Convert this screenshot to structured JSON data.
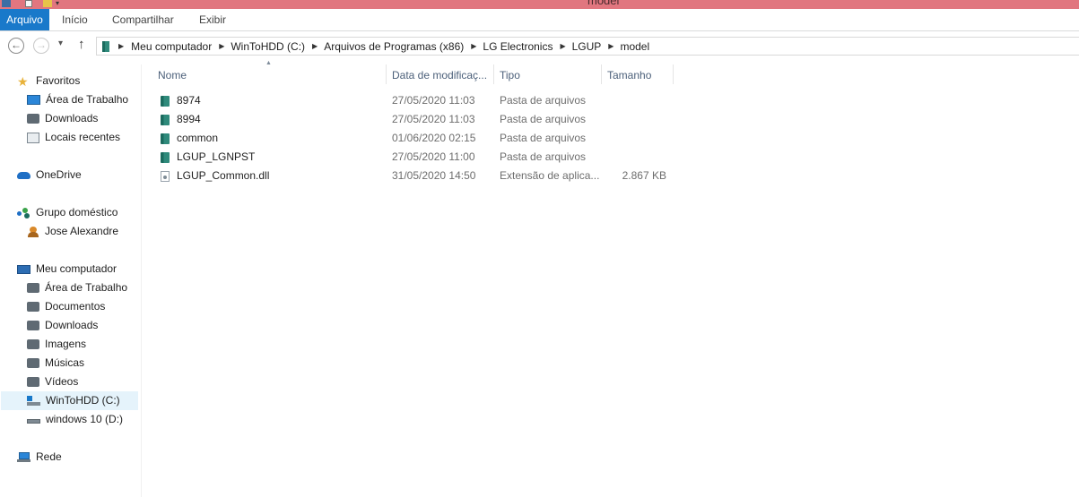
{
  "window": {
    "title": "model"
  },
  "ribbon": {
    "tabs": [
      {
        "label": "Arquivo"
      },
      {
        "label": "Início"
      },
      {
        "label": "Compartilhar"
      },
      {
        "label": "Exibir"
      }
    ]
  },
  "nav": {
    "back": "←",
    "forward": "→",
    "recent": "▾",
    "up": "↑"
  },
  "address": {
    "crumbs": [
      "Meu computador",
      "WinToHDD (C:)",
      "Arquivos de Programas (x86)",
      "LG Electronics",
      "LGUP",
      "model"
    ]
  },
  "navpane": {
    "favorites": {
      "label": "Favoritos",
      "items": [
        "Área de Trabalho",
        "Downloads",
        "Locais recentes"
      ]
    },
    "onedrive": {
      "label": "OneDrive"
    },
    "homegroup": {
      "label": "Grupo doméstico",
      "items": [
        "Jose Alexandre"
      ]
    },
    "computer": {
      "label": "Meu computador",
      "items": [
        "Área de Trabalho",
        "Documentos",
        "Downloads",
        "Imagens",
        "Músicas",
        "Vídeos",
        "WinToHDD (C:)",
        "windows 10 (D:)"
      ]
    },
    "network": {
      "label": "Rede"
    }
  },
  "columns": {
    "name": "Nome",
    "date": "Data de modificaç...",
    "type": "Tipo",
    "size": "Tamanho"
  },
  "files": [
    {
      "name": "8974",
      "date": "27/05/2020 11:03",
      "type": "Pasta de arquivos",
      "size": ""
    },
    {
      "name": "8994",
      "date": "27/05/2020 11:03",
      "type": "Pasta de arquivos",
      "size": ""
    },
    {
      "name": "common",
      "date": "01/06/2020 02:15",
      "type": "Pasta de arquivos",
      "size": ""
    },
    {
      "name": "LGUP_LGNPST",
      "date": "27/05/2020 11:00",
      "type": "Pasta de arquivos",
      "size": ""
    },
    {
      "name": "LGUP_Common.dll",
      "date": "31/05/2020 14:50",
      "type": "Extensão de aplica...",
      "size": "2.867 KB"
    }
  ],
  "colors": {
    "accent": "#1979ca",
    "titlebar": "#e1767f"
  }
}
